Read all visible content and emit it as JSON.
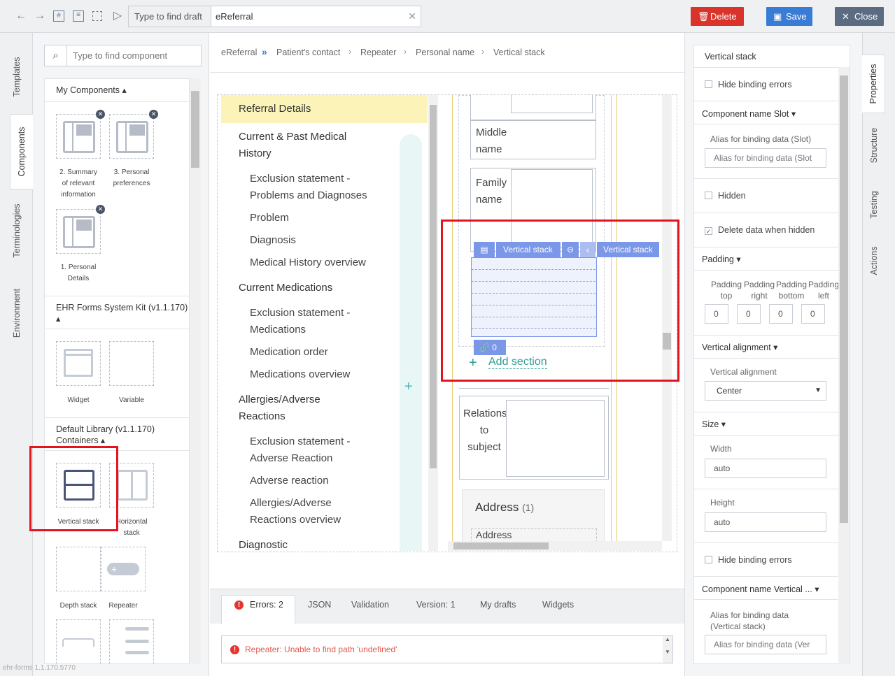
{
  "toolbar": {
    "search_placeholder": "Type to find draft",
    "search_value": "eReferral",
    "delete_label": "Delete",
    "save_label": "Save",
    "close_label": "Close",
    "colors": {
      "delete": "#d9342b",
      "save": "#3a7bd5",
      "close": "#5a6b82"
    }
  },
  "left_tabs": [
    "Templates",
    "Components",
    "Terminologies",
    "Environment"
  ],
  "left_panel": {
    "search_placeholder": "Type to find component",
    "sections": [
      {
        "title": "My Components",
        "items": [
          "2. Summary of relevant information",
          "3. Personal preferences",
          "1. Personal Details"
        ]
      },
      {
        "title": "EHR Forms System Kit (v1.1.170)",
        "items": [
          "Widget",
          "Variable"
        ]
      },
      {
        "title": "Default Library (v1.1.170) Containers",
        "items": [
          "Vertical stack",
          "Horizontal stack",
          "Depth stack",
          "Repeater"
        ]
      }
    ],
    "summary_lines": [
      "2. Summary",
      "of relevant",
      "information"
    ],
    "prefs_lines": [
      "3. Personal",
      "preferences"
    ],
    "personal_lines": [
      "1. Personal",
      "Details"
    ],
    "horizontal_lines": [
      "Horizontal",
      "stack"
    ]
  },
  "version": "ehr-forms 1.1.170.5770",
  "breadcrumb": [
    "eReferral",
    "Patient's contact",
    "Repeater",
    "Personal name",
    "Vertical stack"
  ],
  "nav": {
    "active": "Referral Details",
    "groups": [
      {
        "title": "Current & Past Medical History",
        "title_lines": [
          "Current & Past Medical",
          "History"
        ],
        "items": [
          [
            "Exclusion statement -",
            "Problems and Diagnoses"
          ],
          [
            "Problem"
          ],
          [
            "Diagnosis"
          ],
          [
            "Medical History overview"
          ]
        ]
      },
      {
        "title": "Current Medications",
        "title_lines": [
          "Current Medications"
        ],
        "items": [
          [
            "Exclusion statement -",
            "Medications"
          ],
          [
            "Medication order"
          ],
          [
            "Medications overview"
          ]
        ]
      },
      {
        "title": "Allergies/Adverse Reactions",
        "title_lines": [
          "Allergies/Adverse",
          "Reactions"
        ],
        "items": [
          [
            "Exclusion statement -",
            "Adverse Reaction"
          ],
          [
            "Adverse reaction"
          ],
          [
            "Allergies/Adverse",
            "Reactions overview"
          ]
        ]
      },
      {
        "title": "Diagnostic",
        "title_lines": [
          "Diagnostic"
        ],
        "items": []
      }
    ]
  },
  "form": {
    "middle_name": [
      "Middle",
      "name"
    ],
    "family_name": [
      "Family",
      "name"
    ],
    "toolbar_label_1": "Vertical stack",
    "toolbar_label_2": "Vertical stack",
    "binding_count": "0",
    "add_section": "Add section",
    "relations": [
      "Relations",
      "to",
      "subject"
    ],
    "address_title": "Address",
    "address_count": "(1)",
    "address_field": "Address"
  },
  "bottom_tabs": [
    "Errors: 2",
    "JSON",
    "Validation",
    "Version: 1",
    "My drafts",
    "Widgets"
  ],
  "error_message": "Repeater: Unable to find path 'undefined'",
  "right_tabs": [
    "Properties",
    "Structure",
    "Testing",
    "Actions"
  ],
  "properties": {
    "header": "Vertical stack",
    "hide_binding_errors": "Hide binding errors",
    "slot_section": "Component name Slot",
    "alias_label": "Alias for binding data (Slot)",
    "alias_placeholder": "Alias for binding data  (Slot",
    "hidden": "Hidden",
    "delete_when_hidden": "Delete data when hidden",
    "padding_section": "Padding",
    "padding_labels": [
      [
        "Padding",
        "top"
      ],
      [
        "Padding",
        "right"
      ],
      [
        "Padding",
        "bottom"
      ],
      [
        "Padding",
        "left"
      ]
    ],
    "padding_values": [
      "0",
      "0",
      "0",
      "0"
    ],
    "valign_section": "Vertical alignment",
    "valign_label": "Vertical alignment",
    "valign_value": "Center",
    "size_section": "Size",
    "width_label": "Width",
    "width_value": "auto",
    "height_label": "Height",
    "height_value": "auto",
    "hide_binding_errors_2": "Hide binding errors",
    "vs_section": "Component name Vertical ...",
    "alias_vs_label_lines": [
      "Alias for binding data",
      "(Vertical stack)"
    ],
    "alias_vs_placeholder": "Alias for binding data  (Ver"
  }
}
